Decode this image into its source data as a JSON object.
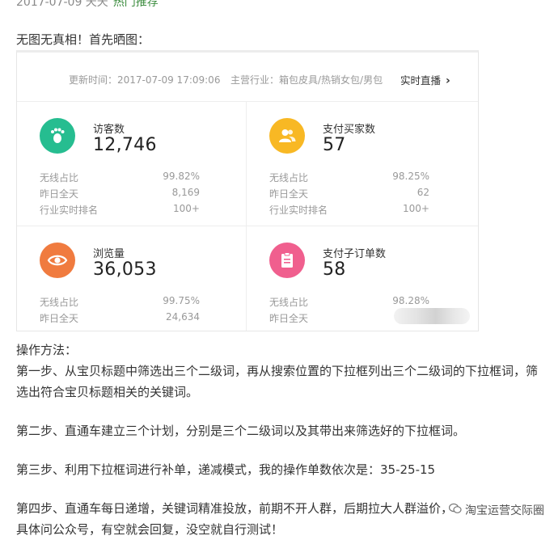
{
  "header": {
    "date_line": "2017-07-09 天天",
    "link_text": "热门推荐"
  },
  "intro": "无图无真相！首先晒图：",
  "dashboard": {
    "update_time": "更新时间：2017-07-09 17:09:06",
    "industry": "主营行业：箱包皮具/热销女包/男包",
    "live_link": "实时直播",
    "cards": [
      {
        "label": "访客数",
        "value": "12,746",
        "color": "#26bd90",
        "icon": "footprint-icon",
        "rows": [
          {
            "k": "无线占比",
            "v": "99.82%"
          },
          {
            "k": "昨日全天",
            "v": "8,169"
          },
          {
            "k": "行业实时排名",
            "v": "100+"
          }
        ]
      },
      {
        "label": "支付买家数",
        "value": "57",
        "color": "#f8b824",
        "icon": "buyers-icon",
        "rows": [
          {
            "k": "无线占比",
            "v": "98.25%"
          },
          {
            "k": "昨日全天",
            "v": "62"
          },
          {
            "k": "行业实时排名",
            "v": "100+"
          }
        ]
      },
      {
        "label": "浏览量",
        "value": "36,053",
        "color": "#f07b3f",
        "icon": "eye-icon",
        "rows": [
          {
            "k": "无线占比",
            "v": "99.75%"
          },
          {
            "k": "昨日全天",
            "v": "24,634"
          }
        ]
      },
      {
        "label": "支付子订单数",
        "value": "58",
        "color": "#f05f8e",
        "icon": "clipboard-icon",
        "rows": [
          {
            "k": "无线占比",
            "v": "98.28%"
          },
          {
            "k": "昨日全天",
            "v": ""
          }
        ]
      }
    ]
  },
  "body": {
    "method_title": "操作方法：",
    "step1": "第一步、从宝贝标题中筛选出三个二级词，再从搜索位置的下拉框列出三个二级词的下拉框词，筛选出符合宝贝标题相关的关键词。",
    "step2": "第二步、直通车建立三个计划，分别是三个二级词以及其带出来筛选好的下拉框词。",
    "step3": "第三步、利用下拉框词进行补单，递减模式，我的操作单数依次是：35-25-15",
    "step4": "第四步、直通车每日递增，关键词精准投放，前期不开人群，后期拉大人群溢价，",
    "step4_cont": "具体问公众号，有空就会回复，没空就自行测试！"
  },
  "watermark": "淘宝运营交际圈"
}
